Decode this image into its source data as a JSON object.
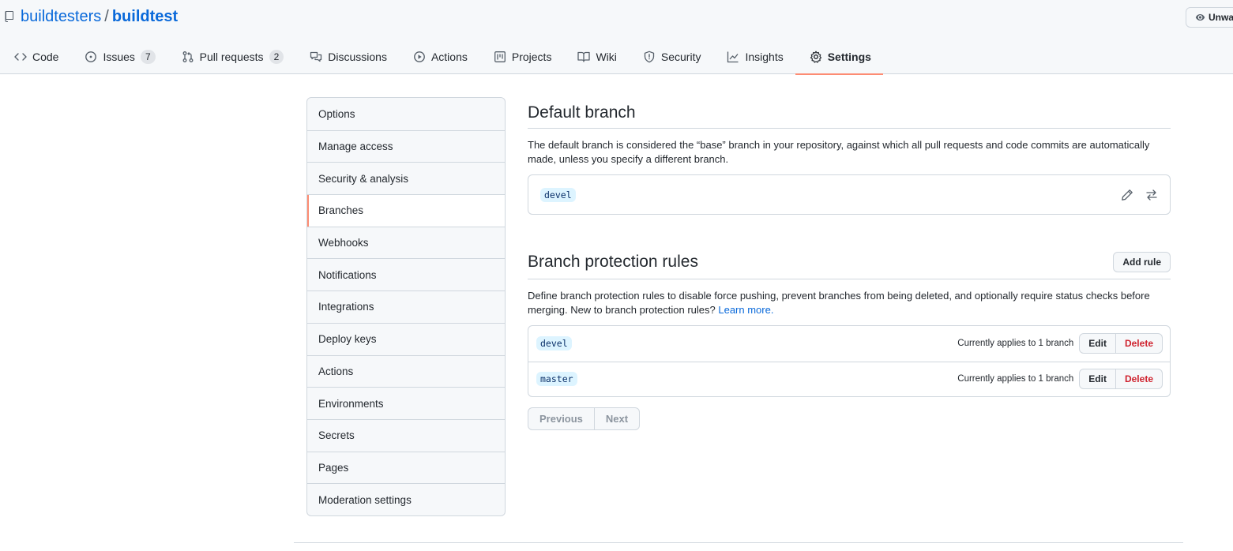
{
  "repo": {
    "owner": "buildtesters",
    "separator": "/",
    "name": "buildtest"
  },
  "watch": {
    "label": "Unwatch"
  },
  "tabs": [
    {
      "label": "Code",
      "icon": "code-icon"
    },
    {
      "label": "Issues",
      "icon": "issue-icon",
      "count": "7"
    },
    {
      "label": "Pull requests",
      "icon": "pull-request-icon",
      "count": "2"
    },
    {
      "label": "Discussions",
      "icon": "discussion-icon"
    },
    {
      "label": "Actions",
      "icon": "play-icon"
    },
    {
      "label": "Projects",
      "icon": "project-icon"
    },
    {
      "label": "Wiki",
      "icon": "book-icon"
    },
    {
      "label": "Security",
      "icon": "shield-icon"
    },
    {
      "label": "Insights",
      "icon": "graph-icon"
    },
    {
      "label": "Settings",
      "icon": "gear-icon",
      "selected": true
    }
  ],
  "sidebar": {
    "items": [
      {
        "label": "Options"
      },
      {
        "label": "Manage access"
      },
      {
        "label": "Security & analysis"
      },
      {
        "label": "Branches",
        "selected": true
      },
      {
        "label": "Webhooks"
      },
      {
        "label": "Notifications"
      },
      {
        "label": "Integrations"
      },
      {
        "label": "Deploy keys"
      },
      {
        "label": "Actions"
      },
      {
        "label": "Environments"
      },
      {
        "label": "Secrets"
      },
      {
        "label": "Pages"
      },
      {
        "label": "Moderation settings"
      }
    ]
  },
  "default_branch": {
    "title": "Default branch",
    "description": "The default branch is considered the “base” branch in your repository, against which all pull requests and code commits are automatically made, unless you specify a different branch.",
    "branch": "devel"
  },
  "protection": {
    "title": "Branch protection rules",
    "add_rule_label": "Add rule",
    "description": "Define branch protection rules to disable force pushing, prevent branches from being deleted, and optionally require status checks before merging. New to branch protection rules?",
    "learn_more": "Learn more.",
    "rules": [
      {
        "branch": "devel",
        "applies": "Currently applies to 1 branch",
        "edit": "Edit",
        "delete": "Delete"
      },
      {
        "branch": "master",
        "applies": "Currently applies to 1 branch",
        "edit": "Edit",
        "delete": "Delete"
      }
    ],
    "pager": {
      "previous": "Previous",
      "next": "Next"
    }
  },
  "colors": {
    "link": "#0969da",
    "selected_accent": "#fd8c73",
    "danger": "#cf222e",
    "border": "#d0d7de"
  }
}
